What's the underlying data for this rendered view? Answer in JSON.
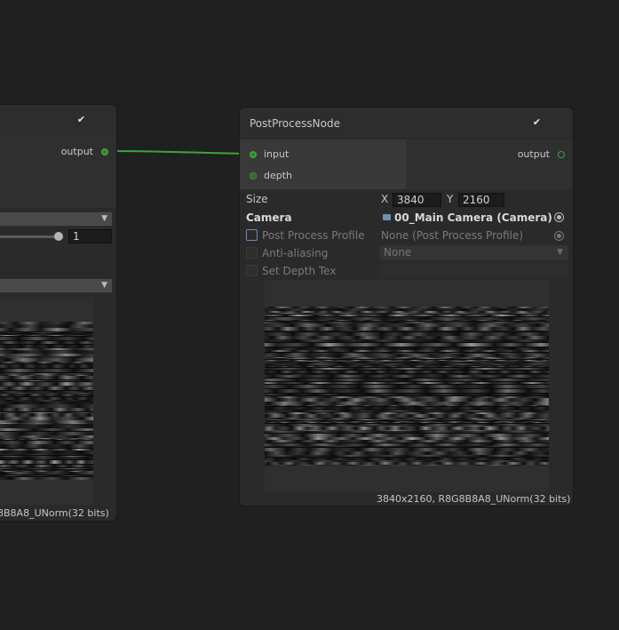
{
  "left_node": {
    "output_port_label": "output",
    "slider_value": "1",
    "footer_info": "8B8A8_UNorm(32 bits)"
  },
  "post_process_node": {
    "title": "PostProcessNode",
    "inputs": [
      {
        "label": "input",
        "connected": true
      },
      {
        "label": "depth",
        "connected": false
      }
    ],
    "output_port_label": "output",
    "size": {
      "label": "Size",
      "x_label": "X",
      "x_value": "3840",
      "y_label": "Y",
      "y_value": "2160"
    },
    "camera": {
      "label": "Camera",
      "value": "00_Main Camera (Camera)",
      "icon": "camera-icon"
    },
    "post_process_profile": {
      "label": "Post Process Profile",
      "value": "None (Post Process Profile)"
    },
    "anti_aliasing": {
      "label": "Anti-aliasing",
      "value": "None"
    },
    "set_depth_tex": {
      "label": "Set Depth Tex"
    },
    "footer_info": "3840x2160, R8G8B8A8_UNorm(32 bits)"
  },
  "colors": {
    "background": "#202020",
    "node_body": "#2a2a2a",
    "connection_wire": "#3ba63b",
    "focus_outline": "#6a8bb7"
  }
}
